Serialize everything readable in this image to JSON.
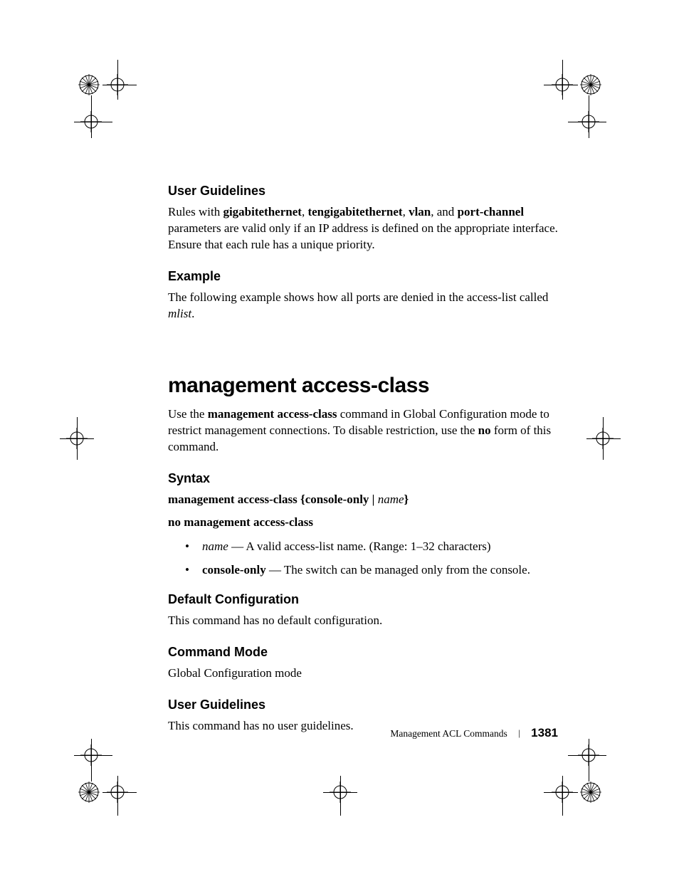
{
  "section1": {
    "heading": "User Guidelines",
    "p_pre": "Rules with ",
    "kw1": "gigabitethernet",
    "sep1": ", ",
    "kw2": "tengigabitethernet",
    "sep2": ", ",
    "kw3": "vlan",
    "sep3": ", and ",
    "kw4": "port-channel",
    "p_post": " parameters are valid only if an IP address is defined on the appropriate interface. Ensure that each rule has a unique priority."
  },
  "section2": {
    "heading": "Example",
    "p": "The following example shows how all ports are denied in the access-list called ",
    "mlist": "mlist",
    "period": "."
  },
  "cmd": {
    "title": "management access-class",
    "intro_pre": "Use the ",
    "intro_cmd": "management access-class",
    "intro_mid": " command in Global Configuration mode to restrict management connections. To disable restriction, use the ",
    "intro_no": "no",
    "intro_post": " form of this command."
  },
  "syntax": {
    "heading": "Syntax",
    "line1_a": "management access-class {console-only | ",
    "line1_b": "name",
    "line1_c": "}",
    "line2": "no management access-class",
    "li1_a": "name",
    "li1_b": " — A valid access-list name. (Range: 1–32 characters)",
    "li2_a": "console-only",
    "li2_b": " — The switch can be managed only from the console."
  },
  "defcfg": {
    "heading": "Default Configuration",
    "body": "This command has no default configuration."
  },
  "cmdmode": {
    "heading": "Command Mode",
    "body": "Global Configuration mode"
  },
  "ug2": {
    "heading": "User Guidelines",
    "body": "This command has no user guidelines."
  },
  "footer": {
    "chapter": "Management ACL Commands",
    "page": "1381"
  }
}
